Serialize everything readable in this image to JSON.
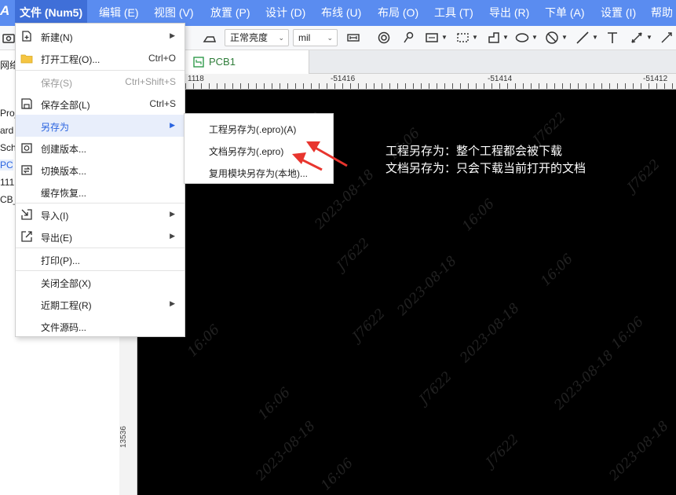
{
  "menubar": {
    "logo": "A",
    "items": [
      {
        "label": "文件 (Num5)"
      },
      {
        "label": "编辑 (E)"
      },
      {
        "label": "视图 (V)"
      },
      {
        "label": "放置 (P)"
      },
      {
        "label": "设计 (D)"
      },
      {
        "label": "布线 (U)"
      },
      {
        "label": "布局 (O)"
      },
      {
        "label": "工具 (T)"
      },
      {
        "label": "导出 (R)"
      },
      {
        "label": "下单 (A)"
      },
      {
        "label": "设置 (I)"
      },
      {
        "label": "帮助"
      }
    ]
  },
  "toolbar": {
    "brightness": "正常亮度",
    "unit": "mil"
  },
  "left_panel": {
    "tree": [
      {
        "label": "网络"
      },
      {
        "label": "Proje"
      },
      {
        "label": "ard"
      },
      {
        "label": "Sch"
      },
      {
        "label": "PC"
      },
      {
        "label": "111"
      },
      {
        "label": "CB_("
      }
    ],
    "vruler_label": "13536"
  },
  "tabs": [
    {
      "label": "PCB1"
    }
  ],
  "ruler": {
    "labels": [
      "1118",
      "-51416",
      "-51414",
      "-51412"
    ]
  },
  "file_menu": {
    "items": [
      {
        "label": "新建(N)",
        "icon": "new-file-icon",
        "shortcut": "",
        "arrow": true
      },
      {
        "label": "打开工程(O)...",
        "icon": "folder-icon",
        "shortcut": "Ctrl+O"
      },
      {
        "label": "保存(S)",
        "shortcut": "Ctrl+Shift+S",
        "disabled": true
      },
      {
        "label": "保存全部(L)",
        "icon": "save-icon",
        "shortcut": "Ctrl+S"
      },
      {
        "label": "另存为",
        "arrow": true,
        "highlighted": true
      },
      {
        "label": "创建版本...",
        "icon": "create-version-icon"
      },
      {
        "label": "切换版本...",
        "icon": "switch-version-icon"
      },
      {
        "label": "缓存恢复..."
      },
      {
        "label": "导入(I)",
        "icon": "import-icon",
        "arrow": true
      },
      {
        "label": "导出(E)",
        "icon": "export-icon",
        "arrow": true
      },
      {
        "label": "打印(P)..."
      },
      {
        "label": "关闭全部(X)"
      },
      {
        "label": "近期工程(R)",
        "arrow": true
      },
      {
        "label": "文件源码..."
      }
    ]
  },
  "save_as_submenu": {
    "items": [
      {
        "label": "工程另存为(.epro)(A)"
      },
      {
        "label": "文档另存为(.epro)"
      },
      {
        "label": "复用模块另存为(本地)..."
      }
    ]
  },
  "annotation": {
    "line1": "工程另存为：整个工程都会被下载",
    "line2": "文档另存为：只会下载当前打开的文档"
  },
  "watermark": {
    "date": "2023-08-18",
    "time": "16:06",
    "id": "J7622"
  },
  "colors": {
    "menubar": "#5a8cf0",
    "active_menu": "#3f6fd8",
    "highlight": "#e8eefb",
    "arrow": "#e8352e",
    "canvas": "#000000"
  }
}
